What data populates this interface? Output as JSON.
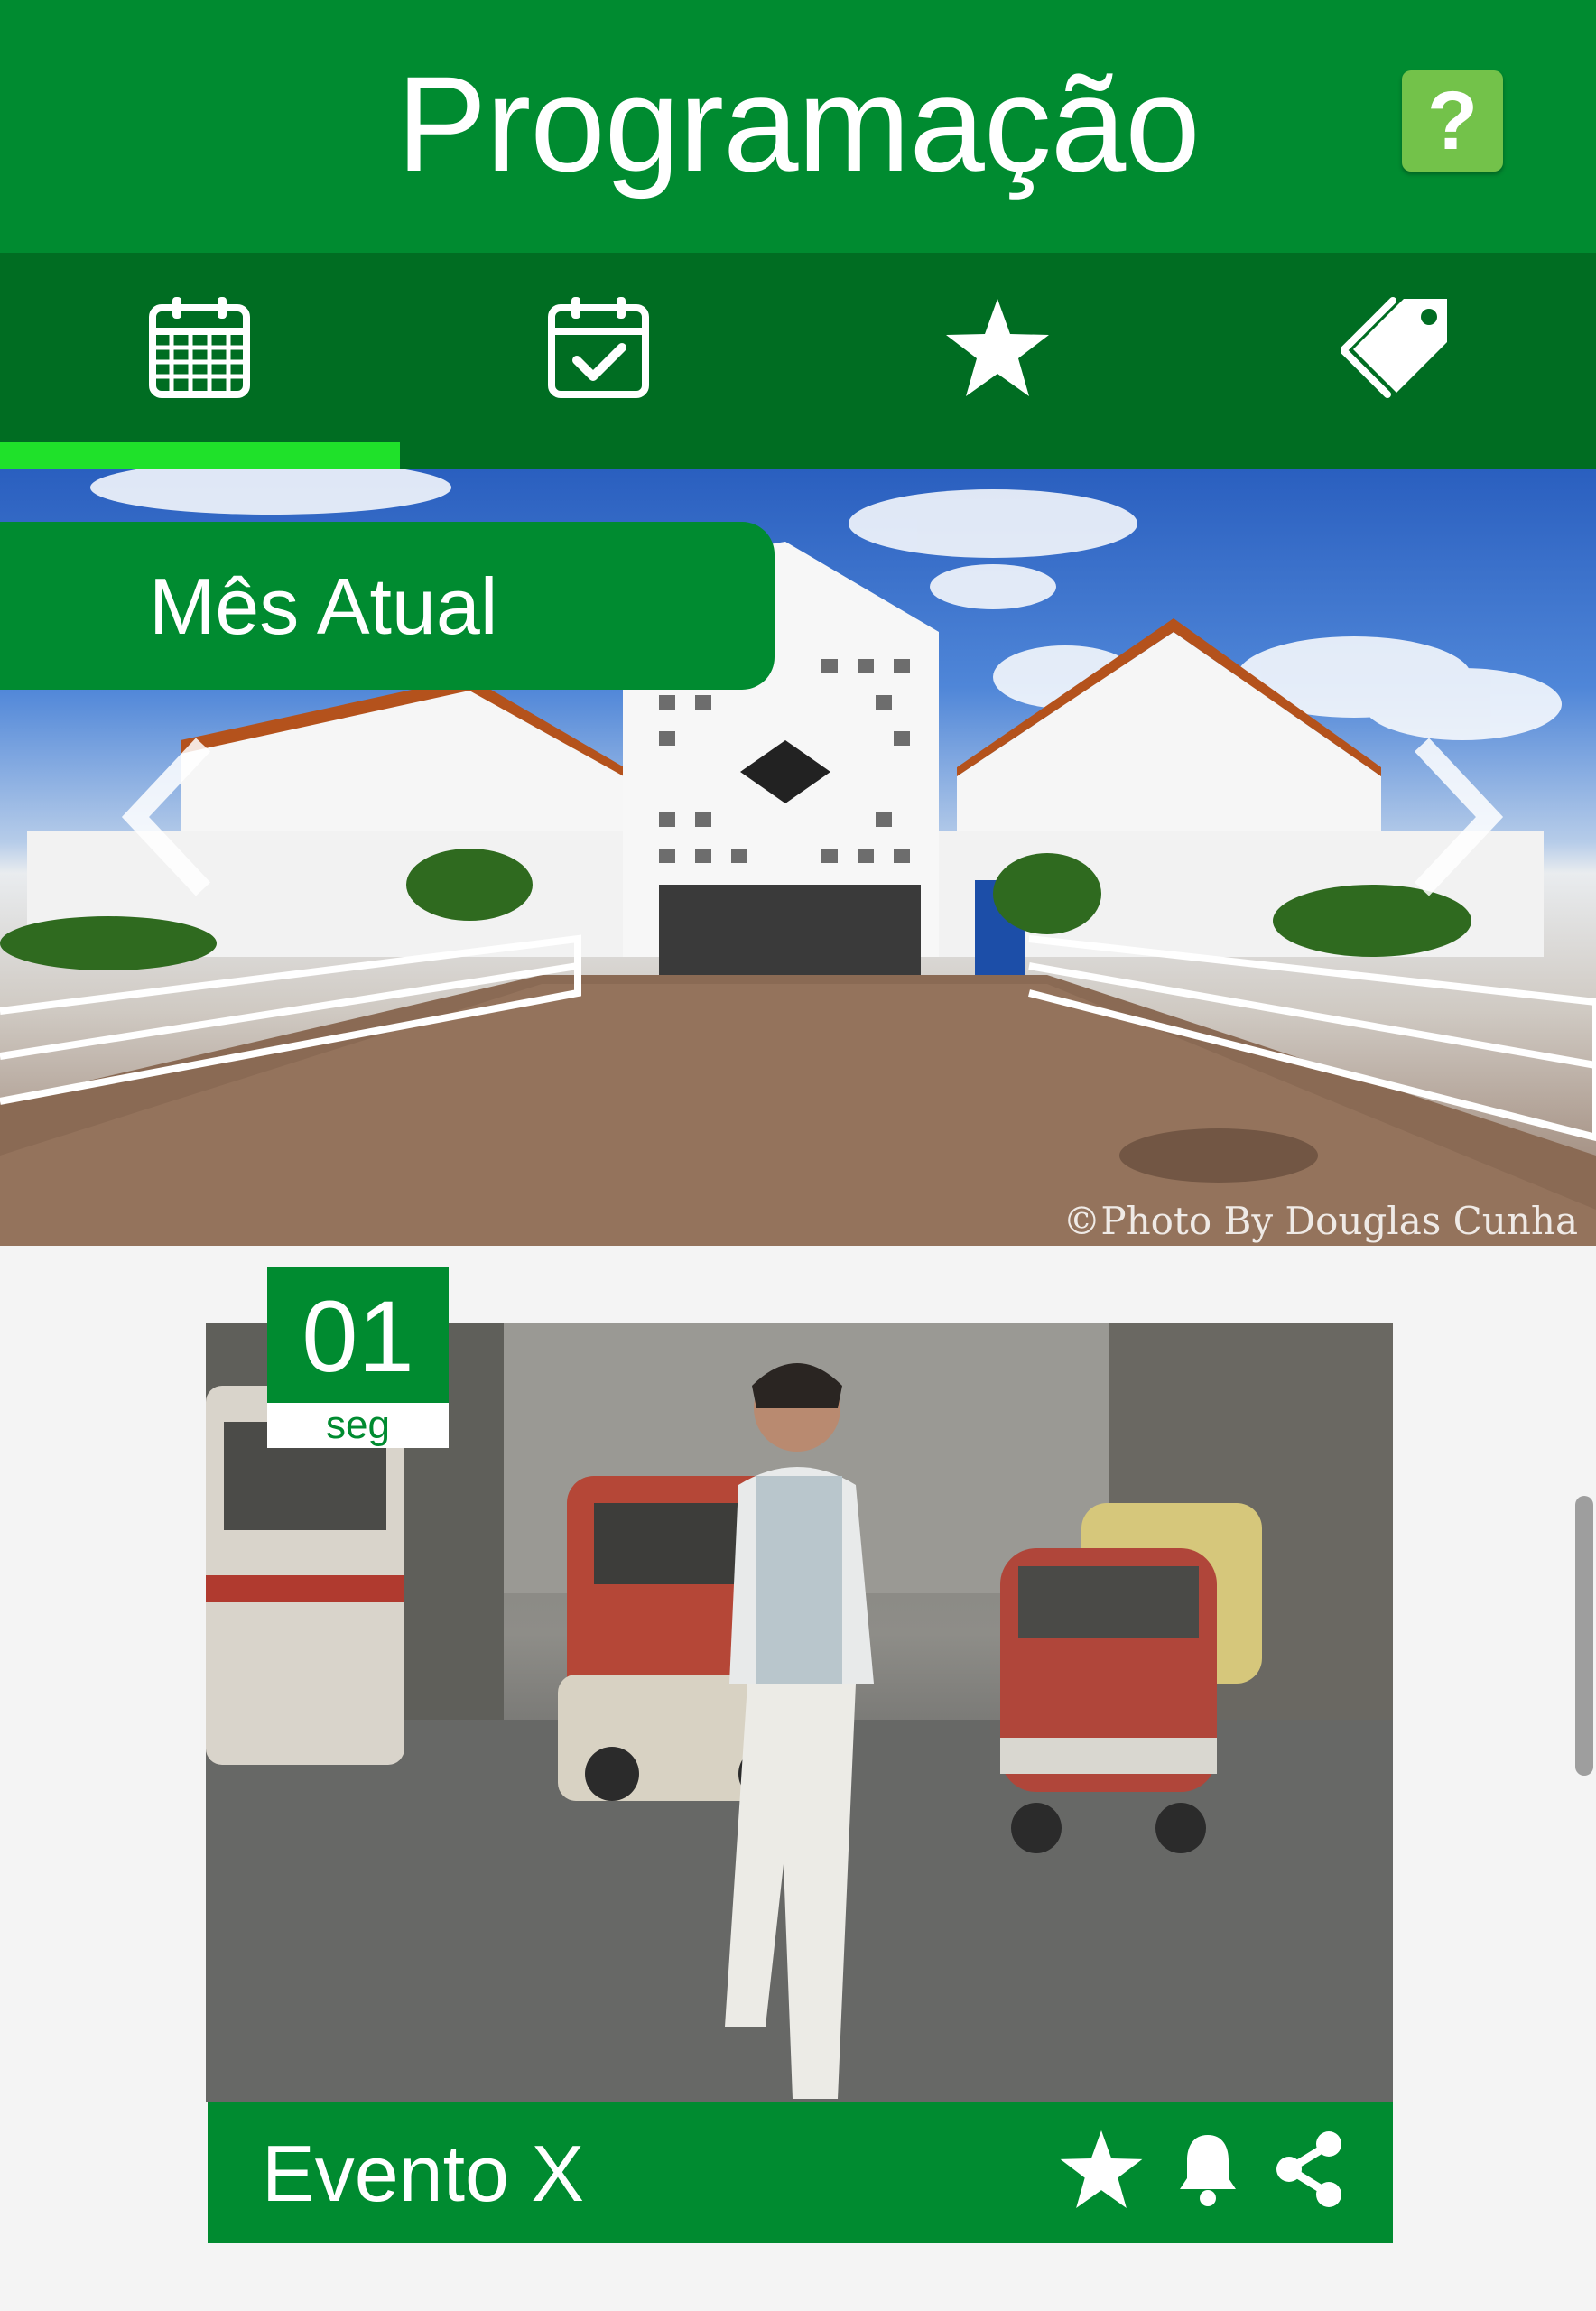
{
  "header": {
    "title": "Programação",
    "help_label": "?"
  },
  "tabs": [
    {
      "icon": "calendar-icon",
      "selected": true
    },
    {
      "icon": "calendar-check-icon",
      "selected": false
    },
    {
      "icon": "star-icon",
      "selected": false
    },
    {
      "icon": "tag-icon",
      "selected": false
    }
  ],
  "hero": {
    "label": "Mês Atual",
    "credit": "©Photo By Douglas Cunha"
  },
  "event": {
    "day": "01",
    "weekday": "seg",
    "title": "Evento X"
  },
  "colors": {
    "primary": "#008b30",
    "tab_bar": "#006d22",
    "tab_indicator": "#1fe12a",
    "help_button": "#73c24a",
    "background": "#f4f4f4"
  }
}
